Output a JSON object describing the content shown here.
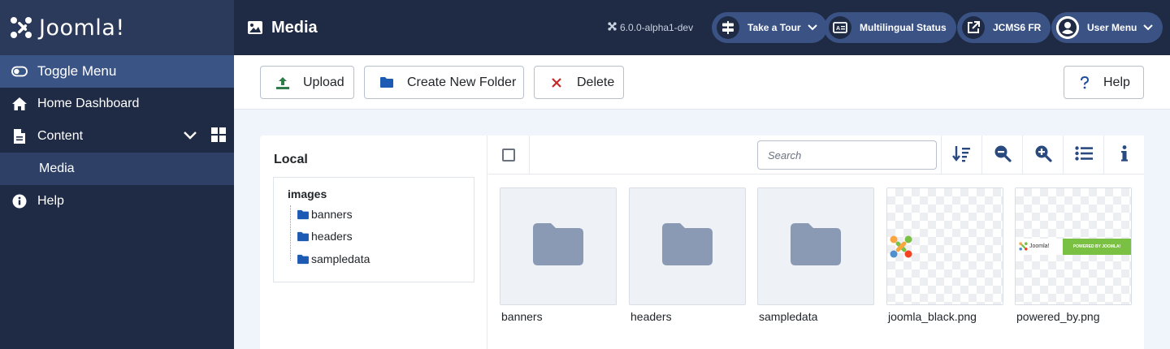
{
  "brand": {
    "name": "Joomla!"
  },
  "sidebar": {
    "items": [
      {
        "label": "Toggle Menu",
        "icon": "toggle-icon"
      },
      {
        "label": "Home Dashboard",
        "icon": "home-icon"
      },
      {
        "label": "Content",
        "icon": "file-icon"
      },
      {
        "label": "Media",
        "icon": ""
      },
      {
        "label": "Help",
        "icon": "info-icon"
      }
    ]
  },
  "header": {
    "title": "Media",
    "version": "6.0.0-alpha1-dev",
    "take_tour": "Take a Tour",
    "multilingual": "Multilingual Status",
    "site": "JCMS6 FR",
    "user_menu": "User Menu"
  },
  "toolbar": {
    "upload": "Upload",
    "new_folder": "Create New Folder",
    "delete": "Delete",
    "help": "Help"
  },
  "tree": {
    "title": "Local",
    "root": "images",
    "folders": [
      "banners",
      "headers",
      "sampledata"
    ]
  },
  "browser": {
    "search_placeholder": "Search",
    "items": [
      {
        "name": "banners",
        "type": "folder"
      },
      {
        "name": "headers",
        "type": "folder"
      },
      {
        "name": "sampledata",
        "type": "folder"
      },
      {
        "name": "joomla_black.png",
        "type": "image"
      },
      {
        "name": "powered_by.png",
        "type": "image",
        "banner_text": "POWERED BY JOOMLA!",
        "logo_text": "Joomla!"
      }
    ]
  },
  "colors": {
    "sidebar_bg": "#1f2a44",
    "accent": "#3b5486",
    "folder": "#8a99b4",
    "joomla_green": "#7ac143",
    "delete_red": "#c52827"
  }
}
